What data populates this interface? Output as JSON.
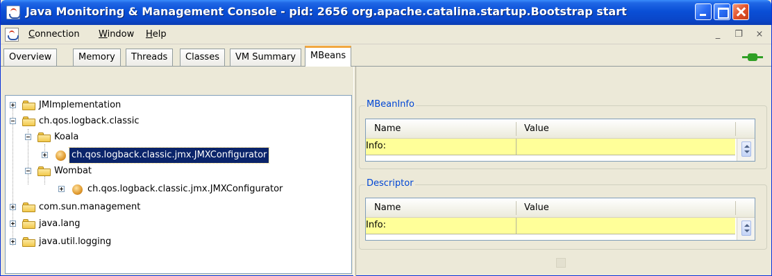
{
  "window": {
    "title": "Java Monitoring & Management Console - pid: 2656 org.apache.catalina.startup.Bootstrap start",
    "app_icon": "java-cup-icon"
  },
  "menu": {
    "items": [
      "Connection",
      "Window",
      "Help"
    ],
    "mdi_minimize": "_",
    "mdi_restore": "❐",
    "mdi_close": "×"
  },
  "tabs": {
    "items": [
      "Overview",
      "Memory",
      "Threads",
      "Classes",
      "VM Summary",
      "MBeans"
    ],
    "active": "MBeans"
  },
  "tree": {
    "nodes": [
      {
        "label": "JMImplementation"
      },
      {
        "label": "ch.qos.logback.classic"
      },
      {
        "label": "Koala"
      },
      {
        "label": "ch.qos.logback.classic.jmx.JMXConfigurator"
      },
      {
        "label": "Wombat"
      },
      {
        "label": "ch.qos.logback.classic.jmx.JMXConfigurator"
      },
      {
        "label": "com.sun.management"
      },
      {
        "label": "java.lang"
      },
      {
        "label": "java.util.logging"
      }
    ]
  },
  "mbean_info": {
    "title": "MBeanInfo",
    "col_name": "Name",
    "col_value": "Value",
    "row_name": "Info:",
    "row_value": ""
  },
  "descriptor": {
    "title": "Descriptor",
    "col_name": "Name",
    "col_value": "Value",
    "row_name": "Info:",
    "row_value": ""
  },
  "colors": {
    "title_bar": "#0a4fd6",
    "selected": "#0a246a",
    "info_row": "#ffff99",
    "group_title": "#0046d5",
    "active_tab_accent": "#f1a740"
  }
}
